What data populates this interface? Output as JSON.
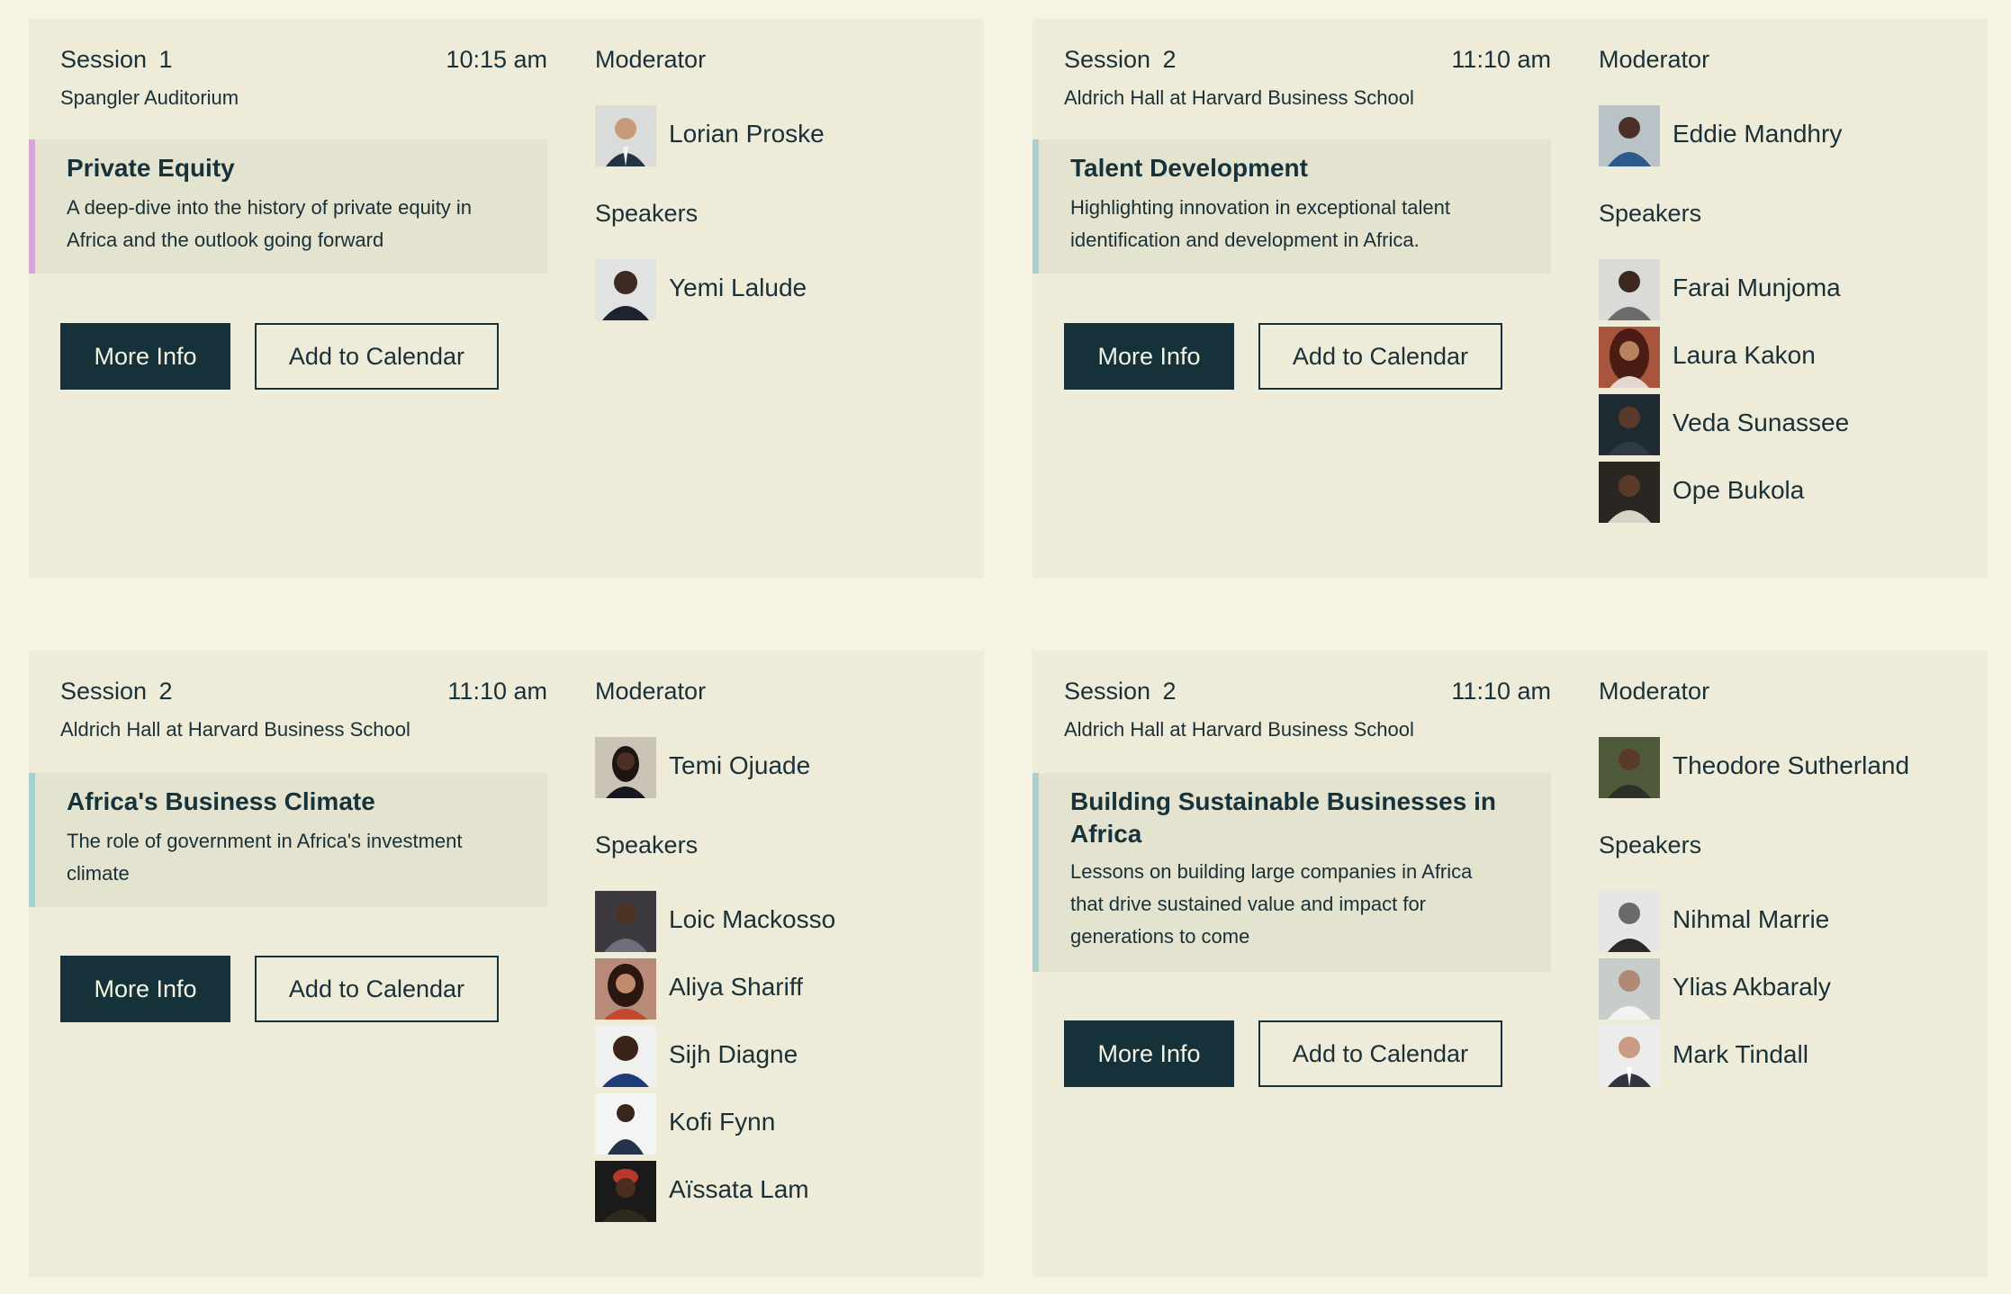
{
  "sessions": [
    {
      "session_label": "Session 1",
      "time": "10:15 am",
      "venue": "Spangler Auditorium",
      "topic_title": "Private Equity",
      "topic_desc_line1": "A deep-dive into the history of private equity in",
      "topic_desc_line2": "Africa and the outlook going forward",
      "accent_color": "#d8a6d7",
      "more_info_label": "More Info",
      "calendar_label": "Add to Calendar",
      "moderator_heading": "Moderator",
      "moderator": "Lorian Proske",
      "speakers_heading": "Speakers",
      "speakers": [
        "Yemi Lalude"
      ]
    },
    {
      "session_label": "Session 2",
      "time": "11:10 am",
      "venue": "Aldrich Hall at Harvard Business School",
      "topic_title": "Talent Development",
      "topic_desc_line1": "Highlighting innovation in exceptional talent",
      "topic_desc_line2": "identification and development in Africa.",
      "accent_color": "#a7cfcd",
      "more_info_label": "More Info",
      "calendar_label": "Add to Calendar",
      "moderator_heading": "Moderator",
      "moderator": "Eddie Mandhry",
      "speakers_heading": "Speakers",
      "speakers": [
        "Farai Munjoma",
        "Laura Kakon",
        "Veda Sunassee",
        "Ope Bukola"
      ]
    },
    {
      "session_label": "Session 2",
      "time": "11:10 am",
      "venue": "Aldrich Hall at Harvard Business School",
      "topic_title": "Africa's Business Climate",
      "topic_desc_line1": "The role of government in Africa's investment",
      "topic_desc_line2": "climate",
      "accent_color": "#a7cfcd",
      "more_info_label": "More Info",
      "calendar_label": "Add to Calendar",
      "moderator_heading": "Moderator",
      "moderator": "Temi Ojuade",
      "speakers_heading": "Speakers",
      "speakers": [
        "Loic Mackosso",
        "Aliya Shariff",
        "Sijh Diagne",
        "Kofi Fynn",
        "Aïssata Lam"
      ]
    },
    {
      "session_label": "Session 2",
      "time": "11:10 am",
      "venue": "Aldrich Hall at Harvard Business School",
      "topic_title_line1": "Building Sustainable Businesses in",
      "topic_title_line2": "Africa",
      "topic_desc_line1": "Lessons on building large companies in Africa",
      "topic_desc_line2": "that drive sustained value and impact for",
      "topic_desc_line3": "generations to come",
      "accent_color": "#a7cfcd",
      "more_info_label": "More Info",
      "calendar_label": "Add to Calendar",
      "moderator_heading": "Moderator",
      "moderator": "Theodore Sutherland",
      "speakers_heading": "Speakers",
      "speakers": [
        "Nihmal Marrie",
        "Ylias Akbaraly",
        "Mark Tindall"
      ]
    }
  ],
  "colors": {
    "page_bg": "#f5f4e2",
    "card_bg": "#eeecd8",
    "topic_bg": "#e3e3cf",
    "primary_button": "#15323a",
    "text": "#1a3038"
  }
}
